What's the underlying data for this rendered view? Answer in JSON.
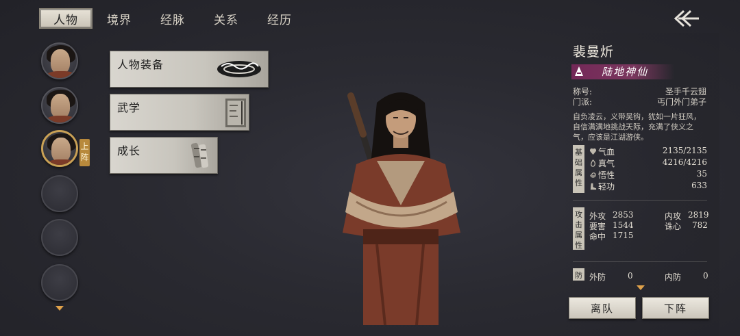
{
  "tabs": [
    {
      "label": "人物",
      "active": true
    },
    {
      "label": "境界",
      "active": false
    },
    {
      "label": "经脉",
      "active": false
    },
    {
      "label": "关系",
      "active": false
    },
    {
      "label": "经历",
      "active": false
    }
  ],
  "party": {
    "onstage_badge": "上阵",
    "members": [
      {
        "state": "character",
        "selected": false
      },
      {
        "state": "character",
        "selected": false
      },
      {
        "state": "character",
        "selected": true
      },
      {
        "state": "empty",
        "selected": false
      },
      {
        "state": "empty",
        "selected": false
      },
      {
        "state": "empty",
        "selected": false
      }
    ]
  },
  "menu": [
    {
      "label": "人物装备",
      "icon": "bracelet-icon"
    },
    {
      "label": "武学",
      "icon": "scroll-book-icon"
    },
    {
      "label": "成长",
      "icon": "scrolls-icon"
    }
  ],
  "character": {
    "name": "裴曼炘",
    "realm": "陆地神仙",
    "title_label": "称号:",
    "title_value": "圣手千云翅",
    "sect_label": "门派:",
    "sect_value": "丐门外门弟子",
    "bio": "自负凌云，义带吴钩，犹如一片狂风，自信满满地挑战天际，充满了侠义之气，应该是江湖游侠。"
  },
  "basic": {
    "tag": "基础属性",
    "stats": [
      {
        "label": "气血",
        "value": "2135/2135",
        "icon": "heart-icon"
      },
      {
        "label": "真气",
        "value": "4216/4216",
        "icon": "flame-icon"
      },
      {
        "label": "悟性",
        "value": "35",
        "icon": "swirl-icon"
      },
      {
        "label": "轻功",
        "value": "633",
        "icon": "boot-icon"
      }
    ]
  },
  "attack": {
    "tag": "攻击属性",
    "stats": [
      {
        "label": "外攻",
        "value": "2853"
      },
      {
        "label": "内攻",
        "value": "2819"
      },
      {
        "label": "要害",
        "value": "1544"
      },
      {
        "label": "诛心",
        "value": "782"
      },
      {
        "label": "命中",
        "value": "1715"
      }
    ]
  },
  "defense": {
    "tag": "防",
    "stats": [
      {
        "label": "外防",
        "value": "0"
      },
      {
        "label": "内防",
        "value": "0"
      }
    ]
  },
  "buttons": {
    "leave": "离队",
    "unassign": "下阵"
  },
  "colors": {
    "accent_gold": "#c9a155",
    "realm_banner": "#7a2a5c",
    "panel_bg": "#2a2a31"
  }
}
